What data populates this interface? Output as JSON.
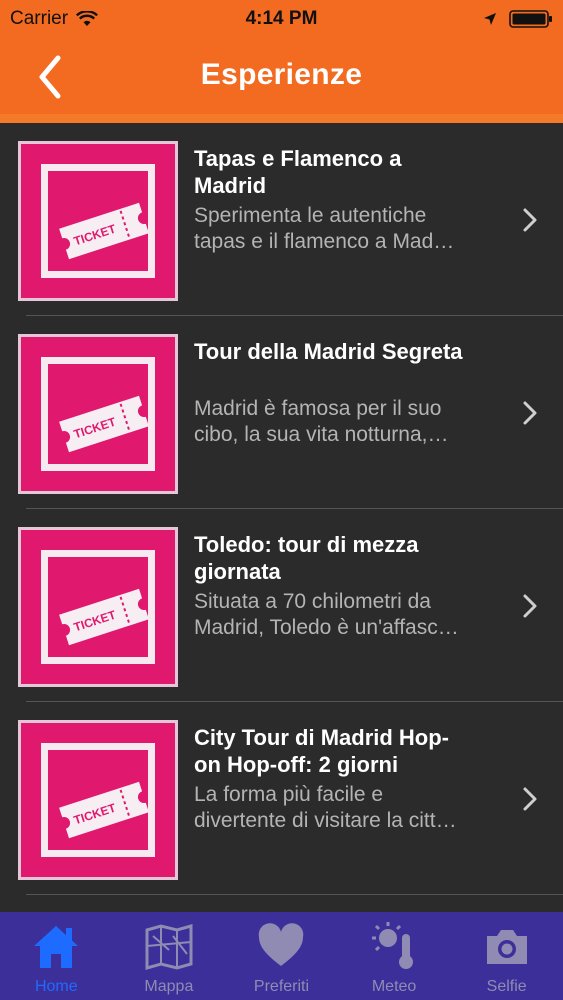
{
  "status": {
    "carrier": "Carrier",
    "time": "4:14 PM"
  },
  "nav": {
    "title": "Esperienze"
  },
  "ticket_text": "TICKET",
  "items": [
    {
      "title_lines": [
        "Tapas e Flamenco a",
        "Madrid"
      ],
      "desc_lines": [
        "Sperimenta le autentiche",
        "tapas e il flamenco a Mad…"
      ]
    },
    {
      "title_lines": [
        "Tour della Madrid Segreta",
        ""
      ],
      "desc_lines": [
        "Madrid è famosa per il suo",
        "cibo, la sua vita notturna,…"
      ]
    },
    {
      "title_lines": [
        "Toledo: tour di mezza",
        "giornata"
      ],
      "desc_lines": [
        "Situata a 70 chilometri da",
        "Madrid, Toledo è un'affasc…"
      ]
    },
    {
      "title_lines": [
        "City Tour di Madrid Hop-",
        "on Hop-off: 2 giorni"
      ],
      "desc_lines": [
        "La forma più facile e",
        "divertente di visitare la citt…"
      ]
    }
  ],
  "tabs": [
    {
      "label": "Home",
      "icon": "home-icon",
      "active": true
    },
    {
      "label": "Mappa",
      "icon": "map-icon",
      "active": false
    },
    {
      "label": "Preferiti",
      "icon": "heart-icon",
      "active": false
    },
    {
      "label": "Meteo",
      "icon": "weather-icon",
      "active": false
    },
    {
      "label": "Selfie",
      "icon": "camera-icon",
      "active": false
    }
  ],
  "colors": {
    "accent": "#f26b21",
    "tab_bar": "#3c2f9a",
    "tab_active": "#1e6bff",
    "thumb": "#e0186e"
  }
}
